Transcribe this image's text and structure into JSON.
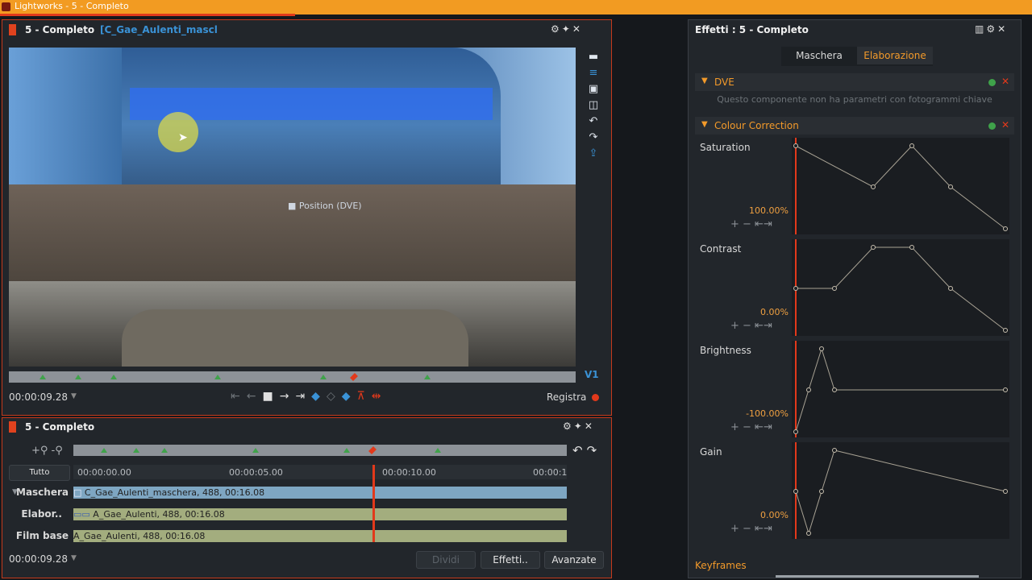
{
  "app_title": "Lightworks - 5 - Completo",
  "viewer": {
    "title": "5 - Completo",
    "clip_name": "[C_Gae_Aulenti_mascl",
    "overlay_label": "Position (DVE)",
    "track_badge": "V1",
    "timecode": "00:00:09.28",
    "record_label": "Registra"
  },
  "timeline": {
    "title": "5 - Completo",
    "all_label": "Tutto",
    "ruler_ticks": [
      "00:00:00.00",
      "00:00:05.00",
      "00:00:10.00",
      "00:00:1"
    ],
    "tracks": [
      {
        "label": "Maschera",
        "clip": "C_Gae_Aulenti_maschera, 488, 00:16.08"
      },
      {
        "label": "Elabor..",
        "clip": "A_Gae_Aulenti, 488, 00:16.08"
      },
      {
        "label": "Film base",
        "clip": "A_Gae_Aulenti, 488, 00:16.08"
      }
    ],
    "timecode": "00:00:09.28",
    "buttons": {
      "split": "Dividi",
      "effects": "Effetti..",
      "advanced": "Avanzate"
    }
  },
  "effects": {
    "title": "Effetti : 5 - Completo",
    "tabs": [
      "Maschera",
      "Elaborazione"
    ],
    "active_tab": "Elaborazione",
    "dve": {
      "name": "DVE",
      "message": "Questo componente non ha parametri con fotogrammi chiave"
    },
    "cc": {
      "name": "Colour Correction"
    },
    "graphs": [
      {
        "name": "Saturation",
        "value": "100.00%"
      },
      {
        "name": "Contrast",
        "value": "0.00%"
      },
      {
        "name": "Brightness",
        "value": "-100.00%"
      },
      {
        "name": "Gain",
        "value": "0.00%"
      }
    ],
    "keyframes_label": "Keyframes"
  },
  "colors": {
    "accent": "#f29b22",
    "playhead": "#e2391b",
    "select": "#3a92d6",
    "keyframe": "#3fa24a"
  }
}
